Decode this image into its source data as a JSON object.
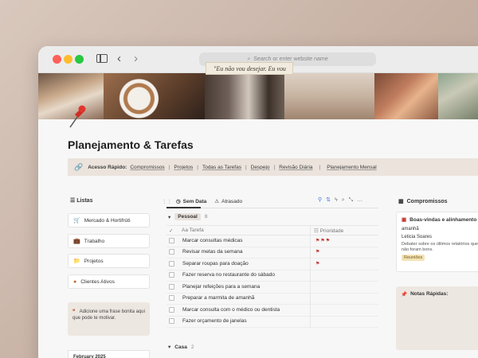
{
  "browser": {
    "address_placeholder": "Search or enter website name"
  },
  "banner": {
    "quote": "\"Eu não vou desejar. Eu vou"
  },
  "page": {
    "title": "Planejamento & Tarefas"
  },
  "quick_access": {
    "label": "Acesso Rápido:",
    "links": [
      "Compromissos",
      "Projetos",
      "Todas as Tarefas",
      "Despejo",
      "Revisão Diária",
      "Planejamento Mensal"
    ]
  },
  "sidebar": {
    "title": "Listas",
    "items": [
      {
        "label": "Mercado & Hortifrúti",
        "icon": "cart-icon"
      },
      {
        "label": "Trabalho",
        "icon": "briefcase-icon"
      },
      {
        "label": "Projetos",
        "icon": "folder-icon"
      },
      {
        "label": "Clientes Ativos",
        "icon": "person-icon"
      }
    ],
    "quote_text": "Adicione uma frase bonita aqui que pode te motivar.",
    "calendar_label": "February 2025"
  },
  "tasks": {
    "tabs": [
      {
        "label": "Sem Data",
        "active": true
      },
      {
        "label": "Atrasado",
        "active": false
      }
    ],
    "group1": {
      "name": "Pessoal",
      "count": "8"
    },
    "group2": {
      "name": "Casa",
      "count": "2"
    },
    "headers": {
      "task": "Tarefa",
      "priority": "Prioridade"
    },
    "rows": [
      {
        "text": "Marcar consultas médicas",
        "priority": "high"
      },
      {
        "text": "Revisar metas da semana",
        "priority": "low"
      },
      {
        "text": "Separar roupas para doação",
        "priority": "low"
      },
      {
        "text": "Fazer reserva no restaurante do sábado",
        "priority": ""
      },
      {
        "text": "Planejar refeições para a semana",
        "priority": ""
      },
      {
        "text": "Preparar a marmita de amanhã",
        "priority": ""
      },
      {
        "text": "Marcar consulta com o médico ou dentista",
        "priority": ""
      },
      {
        "text": "Fazer orçamento de janelas",
        "priority": ""
      }
    ]
  },
  "appointments": {
    "title": "Compromissos",
    "card": {
      "title": "Boas-vindas e alinhamento",
      "when": "amanhã",
      "person": "Leticia Soares",
      "note": "Debater sobre os últimos relatórios que não foram bons.",
      "tag": "Reuniões"
    }
  },
  "notes": {
    "title": "Notas Rápidas:"
  },
  "colors": {
    "accent_red": "#c4322d",
    "quick_bar": "#ebe3dc",
    "tag_bg": "#f3e3b5"
  }
}
